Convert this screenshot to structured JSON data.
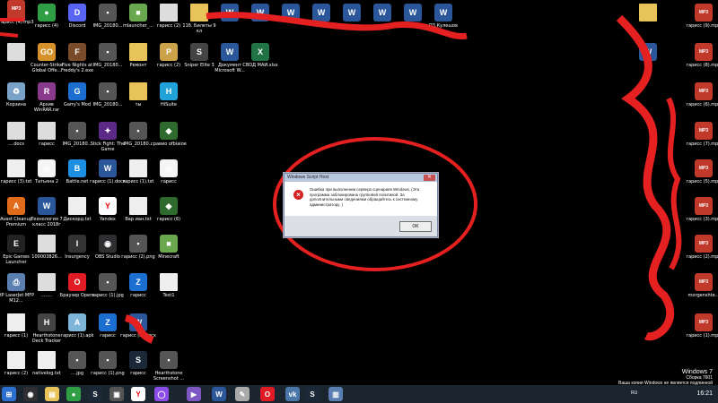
{
  "desktop": {
    "icons": [
      {
        "name": "desktop-icon-redacted",
        "icon": "red-scribble",
        "label": "",
        "color": "#e0312f"
      },
      {
        "name": "desktop-icon-chrome",
        "icon": "chrome-icon",
        "label": "гарисс (4)",
        "color": "#2f9e44"
      },
      {
        "name": "desktop-icon-discord",
        "icon": "discord-icon",
        "label": "Discord",
        "color": "#5865f2"
      },
      {
        "name": "desktop-icon-img-1",
        "icon": "image-icon",
        "label": "IMG_20180...",
        "color": "#555"
      },
      {
        "name": "desktop-icon-mlauncher",
        "icon": "minecraft-icon",
        "label": "mlauncher_...",
        "color": "#6aa84f"
      },
      {
        "name": "desktop-icon-garriss2",
        "icon": "file-icon",
        "label": "гарисс (2)",
        "color": "#ddd"
      },
      {
        "name": "desktop-icon-bilety",
        "icon": "folder-icon",
        "label": "11б. Билеты 9 кл",
        "color": "#e8c35a"
      },
      {
        "name": "desktop-icon-redacted2",
        "icon": "file-icon",
        "label": "",
        "color": "#ddd"
      },
      {
        "name": "desktop-icon-counter-strike",
        "icon": "cs-icon",
        "label": "Counter-Strike Global Offe...",
        "color": "#d6912b"
      },
      {
        "name": "desktop-icon-fnaf",
        "icon": "fnaf-icon",
        "label": "Five Nights at Freddy's 2.exe",
        "color": "#7a4b2a"
      },
      {
        "name": "desktop-icon-img-2",
        "icon": "image-icon",
        "label": "IMG_20180...",
        "color": "#555"
      },
      {
        "name": "desktop-icon-remont",
        "icon": "folder-icon",
        "label": "Ремонт",
        "color": "#e8c35a"
      },
      {
        "name": "desktop-icon-pubg",
        "icon": "pubg-icon",
        "label": "гарисс (2)",
        "color": "#c9a24a"
      },
      {
        "name": "desktop-icon-sniper",
        "icon": "sniper-icon",
        "label": "Sniper Elite 3",
        "color": "#444"
      },
      {
        "name": "desktop-icon-word-doc",
        "icon": "word-icon",
        "label": "Документ Microsoft W...",
        "color": "#2b579a"
      },
      {
        "name": "desktop-icon-svod",
        "icon": "excel-icon",
        "label": "СВОД МАЙ.xlsx",
        "color": "#217346"
      },
      {
        "name": "desktop-icon-trash",
        "icon": "recycle-bin-icon",
        "label": "Корзина",
        "color": "#7aa2c8"
      },
      {
        "name": "desktop-icon-winrar",
        "icon": "winrar-icon",
        "label": "Архив WinRAR.rar",
        "color": "#8a3a8a"
      },
      {
        "name": "desktop-icon-garrysmod",
        "icon": "gmod-icon",
        "label": "Garry's Mod",
        "color": "#1c6fd1"
      },
      {
        "name": "desktop-icon-img-3",
        "icon": "image-icon",
        "label": "IMG_20180...",
        "color": "#555"
      },
      {
        "name": "desktop-icon-ty",
        "icon": "folder-icon",
        "label": "ты",
        "color": "#e8c35a"
      },
      {
        "name": "desktop-icon-hisuite",
        "icon": "hisuite-icon",
        "label": "HiSuite",
        "color": "#21a3d9"
      },
      {
        "name": "desktop-icon-docs",
        "icon": "file-icon",
        "label": "....docs",
        "color": "#ddd"
      },
      {
        "name": "desktop-icon-garriss",
        "icon": "file-icon",
        "label": "гарисс",
        "color": "#ddd"
      },
      {
        "name": "desktop-icon-img-4",
        "icon": "image-icon",
        "label": "IMG_20180...",
        "color": "#555"
      },
      {
        "name": "desktop-icon-stickfight",
        "icon": "stick-icon",
        "label": "Stick Fight: The Game",
        "color": "#5b2a86"
      },
      {
        "name": "desktop-icon-img-5",
        "icon": "image-icon",
        "label": "IMG_20180...",
        "color": "#555"
      },
      {
        "name": "desktop-icon-gravity",
        "icon": "gravity-icon",
        "label": "гравио ofbiaioe",
        "color": "#2f6b2f"
      },
      {
        "name": "desktop-icon-garriss3",
        "icon": "file-icon",
        "label": "гарисс (3).txt",
        "color": "#eee"
      },
      {
        "name": "desktop-icon-tatiana",
        "icon": "overwatch-icon",
        "label": "Татьяна 2",
        "color": "#f4f4f4"
      },
      {
        "name": "desktop-icon-battlenet",
        "icon": "battlenet-icon",
        "label": "Battle.net",
        "color": "#1d8fe1"
      },
      {
        "name": "desktop-icon-garriss-docx",
        "icon": "word-icon",
        "label": "гарисс (1).docx",
        "color": "#2b579a"
      },
      {
        "name": "desktop-icon-garriss1txt",
        "icon": "file-icon",
        "label": "гарисс (1).txt",
        "color": "#eee"
      },
      {
        "name": "desktop-icon-garriss-ow",
        "icon": "overwatch-icon",
        "label": "гарисс",
        "color": "#f4f4f4"
      },
      {
        "name": "desktop-icon-avast",
        "icon": "avast-icon",
        "label": "Avast Cleanup Premium",
        "color": "#e06b1a"
      },
      {
        "name": "desktop-icon-tech7",
        "icon": "word-icon",
        "label": "Технология 7 класс 2018г",
        "color": "#2b579a"
      },
      {
        "name": "desktop-icon-diskord",
        "icon": "file-icon",
        "label": "Дискорд.txt",
        "color": "#eee"
      },
      {
        "name": "desktop-icon-yandex",
        "icon": "yandex-icon",
        "label": "Yandex",
        "color": "#fff"
      },
      {
        "name": "desktop-icon-varian",
        "icon": "file-icon",
        "label": "Вар иан.txt",
        "color": "#eee"
      },
      {
        "name": "desktop-icon-garriss6",
        "icon": "gravity-icon",
        "label": "гарисс (6)",
        "color": "#2f6b2f"
      },
      {
        "name": "desktop-icon-epic",
        "icon": "epic-icon",
        "label": "Epic Games Launcher",
        "color": "#222"
      },
      {
        "name": "desktop-icon-100003",
        "icon": "file-icon",
        "label": "100003826...",
        "color": "#ddd"
      },
      {
        "name": "desktop-icon-insurgency",
        "icon": "insurgency-icon",
        "label": "Insurgency",
        "color": "#333"
      },
      {
        "name": "desktop-icon-obs",
        "icon": "obs-icon",
        "label": "OBS Studio",
        "color": "#302e31"
      },
      {
        "name": "desktop-icon-garriss2png",
        "icon": "image-icon",
        "label": "гарисс (2).png",
        "color": "#555"
      },
      {
        "name": "desktop-icon-minecraft",
        "icon": "minecraft-icon",
        "label": "Minecraft",
        "color": "#6aa84f"
      },
      {
        "name": "desktop-icon-hp-laserjet",
        "icon": "printer-icon",
        "label": "HP LaserJet MFP M12...",
        "color": "#5a7fb0"
      },
      {
        "name": "desktop-icon-dots",
        "icon": "file-icon",
        "label": "........",
        "color": "#ddd"
      },
      {
        "name": "desktop-icon-opera",
        "icon": "opera-icon",
        "label": "Браузер Opera",
        "color": "#e01b24"
      },
      {
        "name": "desktop-icon-garriss1jpg",
        "icon": "image-icon",
        "label": "гарисс (1).jpg",
        "color": "#555"
      },
      {
        "name": "desktop-icon-garriss-z",
        "icon": "z-icon",
        "label": "гарисс",
        "color": "#1b6fd1"
      },
      {
        "name": "desktop-icon-test1",
        "icon": "file-icon",
        "label": "Test1",
        "color": "#eee"
      },
      {
        "name": "desktop-icon-garriss1",
        "icon": "file-icon",
        "label": "гарисс (1)",
        "color": "#eee"
      },
      {
        "name": "desktop-icon-hearthstone-tracker",
        "icon": "hs-tracker-icon",
        "label": "Hearthstone Deck Tracker",
        "color": "#444"
      },
      {
        "name": "desktop-icon-garriss1apk",
        "icon": "apk-icon",
        "label": "гарисс (1).apk",
        "color": "#7fb4d9"
      },
      {
        "name": "desktop-icon-garriss-z2",
        "icon": "z-icon",
        "label": "гарисс",
        "color": "#1b6fd1"
      },
      {
        "name": "desktop-icon-garriss2docx",
        "icon": "word-icon",
        "label": "гарисс (2).docx",
        "color": "#2b579a"
      },
      {
        "name": "desktop-icon-garriss2b",
        "icon": "file-icon",
        "label": "гарисс (2)",
        "color": "#eee"
      },
      {
        "name": "desktop-icon-nativelog",
        "icon": "file-icon",
        "label": "nativelog.txt",
        "color": "#eee"
      },
      {
        "name": "desktop-icon-blank-jpg",
        "icon": "image-icon",
        "label": "....jpg",
        "color": "#555"
      },
      {
        "name": "desktop-icon-garriss1png",
        "icon": "image-icon",
        "label": "гарисс (1).png",
        "color": "#555"
      },
      {
        "name": "desktop-icon-steam",
        "icon": "steam-icon",
        "label": "гарисс",
        "color": "#1b2838"
      },
      {
        "name": "desktop-icon-hs-screenshot",
        "icon": "image-icon",
        "label": "Hearthstone Screenshot ...",
        "color": "#555"
      },
      {
        "name": "desktop-icon-row-top-5",
        "icon": "word-icon",
        "label": "",
        "color": "#2b579a"
      },
      {
        "name": "desktop-icon-row-top-6",
        "icon": "word-icon",
        "label": "",
        "color": "#2b579a"
      },
      {
        "name": "desktop-icon-row-top-7",
        "icon": "word-icon",
        "label": "",
        "color": "#2b579a"
      },
      {
        "name": "desktop-icon-row-top-8",
        "icon": "word-icon",
        "label": "",
        "color": "#2b579a"
      },
      {
        "name": "desktop-icon-row-top-9",
        "icon": "word-icon",
        "label": "",
        "color": "#2b579a"
      },
      {
        "name": "desktop-icon-row-top-10",
        "icon": "word-icon",
        "label": "",
        "color": "#2b579a"
      },
      {
        "name": "desktop-icon-row-top-11",
        "icon": "word-icon",
        "label": "",
        "color": "#2b579a"
      },
      {
        "name": "desktop-icon-kuleshov",
        "icon": "word-icon",
        "label": "П3.Кулешов",
        "color": "#2b579a"
      },
      {
        "name": "desktop-icon-right-1",
        "icon": "folder-icon",
        "label": "",
        "color": "#e8c35a"
      },
      {
        "name": "desktop-icon-right-2",
        "icon": "word-icon",
        "label": "",
        "color": "#2b579a"
      },
      {
        "name": "desktop-icon-mp3-1",
        "icon": "mp3-icon",
        "label": "гарисс (9).mp3",
        "color": "#c0392b"
      },
      {
        "name": "desktop-icon-mp3-2",
        "icon": "mp3-icon",
        "label": "гарисс (8).mp3",
        "color": "#c0392b"
      },
      {
        "name": "desktop-icon-mp3-3",
        "icon": "mp3-icon",
        "label": "гарисс (6).mp3",
        "color": "#c0392b"
      },
      {
        "name": "desktop-icon-mp3-4",
        "icon": "mp3-icon",
        "label": "гарисс (7).mp3",
        "color": "#c0392b"
      },
      {
        "name": "desktop-icon-mp3-5",
        "icon": "mp3-icon",
        "label": "гарисс (5).mp3",
        "color": "#c0392b"
      },
      {
        "name": "desktop-icon-mp3-6",
        "icon": "mp3-icon",
        "label": "гарисс (3).mp3",
        "color": "#c0392b"
      },
      {
        "name": "desktop-icon-mp3-7",
        "icon": "mp3-icon",
        "label": "гарисс (2).mp3",
        "color": "#c0392b"
      },
      {
        "name": "desktop-icon-mp3-8",
        "icon": "mp3-icon",
        "label": "гарисс (1).mp3",
        "color": "#c0392b"
      },
      {
        "name": "desktop-icon-mp3-9",
        "icon": "mp3-icon",
        "label": "morgenshte...",
        "color": "#c0392b"
      },
      {
        "name": "desktop-icon-mp3-10",
        "icon": "mp3-icon",
        "label": "гарисс (4).mp3",
        "color": "#c0392b"
      }
    ]
  },
  "dialog": {
    "title": "Windows Script Host",
    "message": "Ошибка при выполнении сервера сценариев Windows. (Эта программа заблокирована групповой политикой. За дополнительными сведениями обращайтесь к системному администратору. )",
    "ok_label": "OK",
    "close_label": "✕",
    "error_icon": "error-icon"
  },
  "watermark": {
    "line1": "Windows 7",
    "line2": "Сборка 7601",
    "line3": "Ваша копия Windows не является подлинной"
  },
  "taskbar": {
    "items": [
      {
        "name": "taskbar-start-button",
        "icon": "windows-icon",
        "color": "#2b6fd0"
      },
      {
        "name": "taskbar-item-obs",
        "icon": "obs-icon",
        "color": "#302e31"
      },
      {
        "name": "taskbar-item-explorer",
        "icon": "folder-icon",
        "color": "#e8c35a"
      },
      {
        "name": "taskbar-item-chrome",
        "icon": "chrome-icon",
        "color": "#2f9e44"
      },
      {
        "name": "taskbar-item-steam",
        "icon": "steam-icon",
        "color": "#1b2838"
      },
      {
        "name": "taskbar-item-unknown",
        "icon": "app-icon",
        "color": "#555"
      },
      {
        "name": "taskbar-item-yandex",
        "icon": "yandex-icon",
        "color": "#fff"
      },
      {
        "name": "taskbar-item-alice",
        "icon": "alice-icon",
        "color": "#8a4de8"
      },
      {
        "name": "taskbar-item-vstudio",
        "icon": "vs-icon",
        "color": "#7e57c2"
      },
      {
        "name": "taskbar-item-word",
        "icon": "word-icon",
        "color": "#2b579a"
      },
      {
        "name": "taskbar-item-paint",
        "icon": "paint-icon",
        "color": "#aaa"
      },
      {
        "name": "taskbar-item-opera",
        "icon": "opera-icon",
        "color": "#e01b24"
      },
      {
        "name": "taskbar-item-vk",
        "icon": "vk-icon",
        "color": "#4a76a8"
      },
      {
        "name": "taskbar-item-steam2",
        "icon": "steam-icon",
        "color": "#1b2838"
      },
      {
        "name": "taskbar-item-script",
        "icon": "script-icon",
        "color": "#5a7fb0"
      }
    ],
    "language": "RU",
    "clock": "16:21"
  }
}
